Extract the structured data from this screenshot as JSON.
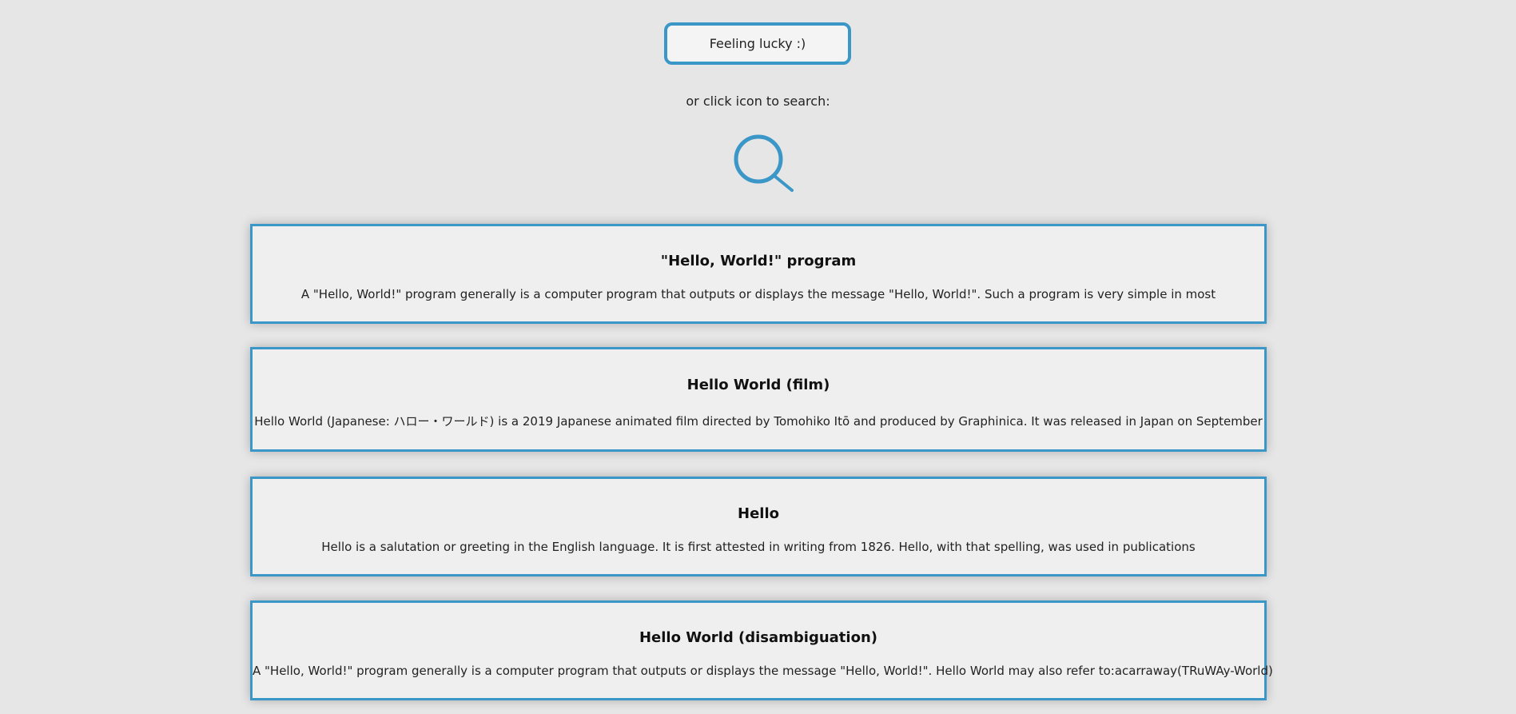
{
  "lucky_button": {
    "label": "Feeling lucky :)"
  },
  "hint_text": "or click icon to search:",
  "search_icon": {
    "name": "search-icon",
    "color": "#3a97c7"
  },
  "accent_color": "#3a97c7",
  "results": [
    {
      "title": "\"Hello, World!\" program",
      "snippet": "A \"Hello, World!\" program generally is a computer program that outputs or displays the message \"Hello, World!\". Such a program is very simple in most"
    },
    {
      "title": "Hello World (film)",
      "snippet": "Hello World (Japanese: ハロー・ワールド) is a 2019 Japanese animated film directed by Tomohiko Itō and produced by Graphinica. It was released in Japan on September"
    },
    {
      "title": "Hello",
      "snippet": "Hello is a salutation or greeting in the English language. It is first attested in writing from 1826. Hello, with that spelling, was used in publications"
    },
    {
      "title": "Hello World (disambiguation)",
      "snippet": "A \"Hello, World!\" program generally is a computer program that outputs or displays the message \"Hello, World!\". Hello World may also refer to:acarraway(TRuWAy-World)"
    }
  ]
}
